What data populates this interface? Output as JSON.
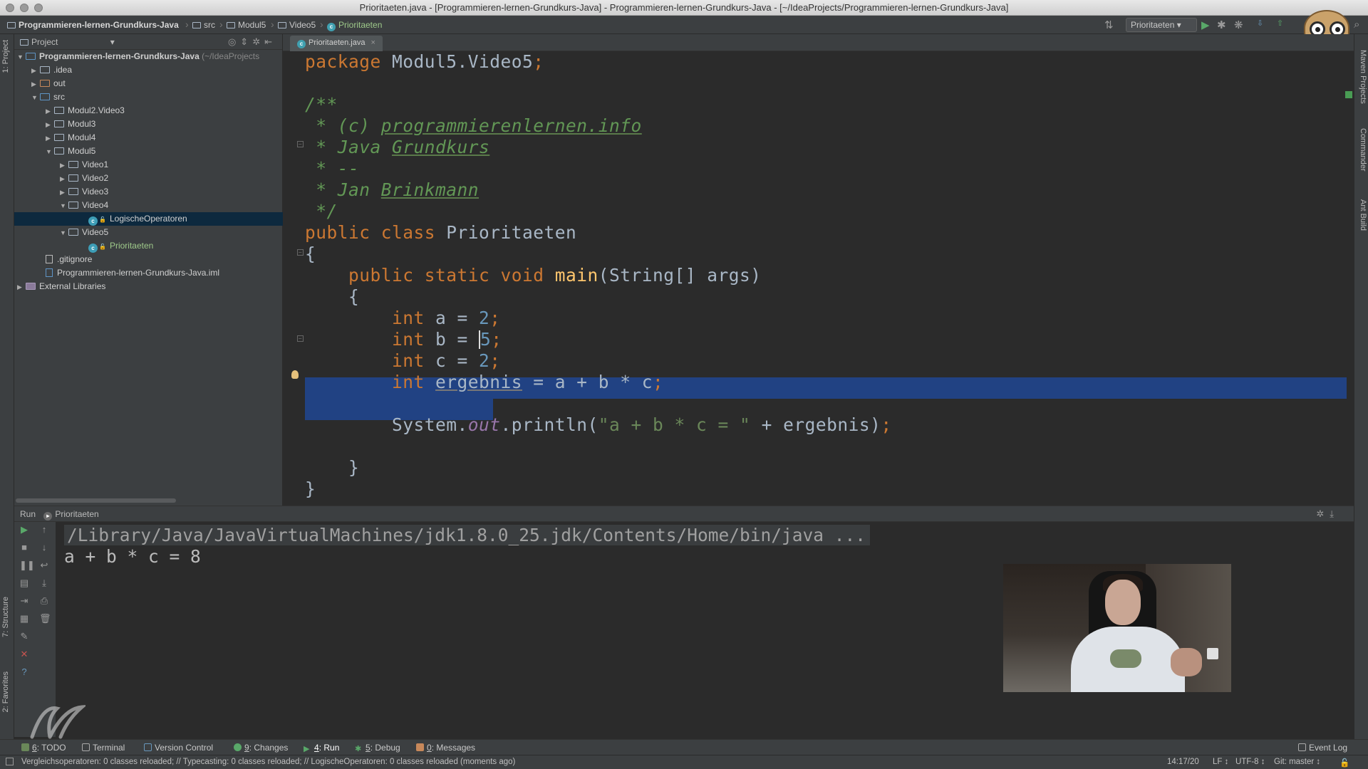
{
  "window": {
    "title": "Prioritaeten.java - [Programmieren-lernen-Grundkurs-Java] - Programmieren-lernen-Grundkurs-Java - [~/IdeaProjects/Programmieren-lernen-Grundkurs-Java]"
  },
  "breadcrumbs": [
    "Programmieren-lernen-Grundkurs-Java",
    "src",
    "Modul5",
    "Video5",
    "Prioritaeten"
  ],
  "toolbar": {
    "run_config": "Prioritaeten",
    "icons": [
      "structure-icon",
      "run-icon",
      "debug-icon",
      "coverage-icon",
      "vcs-update-icon",
      "vcs-commit-icon",
      "settings-icon",
      "search-icon"
    ]
  },
  "left_strip": {
    "project_tab": "1: Project",
    "structure_tab": "7: Structure",
    "favorites_tab": "2: Favorites"
  },
  "right_strip": {
    "maven_tab": "Maven Projects",
    "commander_tab": "Commander",
    "ant_tab": "Ant Build"
  },
  "project_panel": {
    "header": "Project",
    "tree": [
      {
        "label": "Programmieren-lernen-Grundkurs-Java",
        "suffix": " (~/IdeaProjects",
        "kind": "module"
      },
      {
        "label": ".idea",
        "kind": "folder"
      },
      {
        "label": "out",
        "kind": "folder-orange"
      },
      {
        "label": "src",
        "kind": "folder-src"
      },
      {
        "label": "Modul2.Video3",
        "kind": "package"
      },
      {
        "label": "Modul3",
        "kind": "package"
      },
      {
        "label": "Modul4",
        "kind": "package"
      },
      {
        "label": "Modul5",
        "kind": "package"
      },
      {
        "label": "Video1",
        "kind": "package"
      },
      {
        "label": "Video2",
        "kind": "package"
      },
      {
        "label": "Video3",
        "kind": "package"
      },
      {
        "label": "Video4",
        "kind": "package"
      },
      {
        "label": "LogischeOperatoren",
        "kind": "class"
      },
      {
        "label": "Video5",
        "kind": "package"
      },
      {
        "label": "Prioritaeten",
        "kind": "class-active"
      },
      {
        "label": ".gitignore",
        "kind": "file"
      },
      {
        "label": "Programmieren-lernen-Grundkurs-Java.iml",
        "kind": "iml"
      },
      {
        "label": "External Libraries",
        "kind": "library"
      }
    ]
  },
  "editor": {
    "tab_label": "Prioritaeten.java",
    "lines": {
      "l1a": "package ",
      "l1b": "Modul5.Video5",
      "l1c": ";",
      "l3": "/**",
      "l4a": " * (c) ",
      "l4b": "programmierenlernen.info",
      "l5a": " * Java ",
      "l5b": "Grundkurs",
      "l6": " * --",
      "l7a": " * Jan ",
      "l7b": "Brinkmann",
      "l8": " */",
      "l9a": "public class ",
      "l9b": "Prioritaeten",
      "l10": "{",
      "l11a": "    public static void ",
      "l11b": "main",
      "l11c": "(String[] args)",
      "l12": "    {",
      "l13a": "        int ",
      "l13b": "a = ",
      "l13c": "2",
      "l13d": ";",
      "l14a": "        int ",
      "l14b": "b = ",
      "l14c": "5",
      "l14d": ";",
      "l15a": "        int ",
      "l15b": "c = ",
      "l15c": "2",
      "l15d": ";",
      "l16a": "        int ",
      "l16b": "ergebnis",
      "l16c": " = a + b * c",
      "l16d": ";",
      "l18a": "        System.",
      "l18b": "out",
      "l18c": ".println(",
      "l18d": "\"a + b * c = \"",
      "l18e": " + ergebnis)",
      "l18f": ";",
      "l20": "    }",
      "l21": "}"
    }
  },
  "run_panel": {
    "header_label": "Run",
    "config_name": "Prioritaeten",
    "command": "/Library/Java/JavaVirtualMachines/jdk1.8.0_25.jdk/Contents/Home/bin/java ...",
    "output": "a + b * c = 8"
  },
  "bottom_tabs": [
    {
      "num": "6",
      "label": ": TODO"
    },
    {
      "num": "",
      "label": "Terminal"
    },
    {
      "num": "",
      "label": "Version Control"
    },
    {
      "num": "9",
      "label": ": Changes"
    },
    {
      "num": "4",
      "label": ": Run"
    },
    {
      "num": "5",
      "label": ": Debug"
    },
    {
      "num": "0",
      "label": ": Messages"
    }
  ],
  "event_log": "Event Log",
  "status": {
    "message": "Vergleichsoperatoren: 0 classes reloaded; // Typecasting: 0 classes reloaded; // LogischeOperatoren: 0 classes reloaded (moments ago)",
    "position": "14:17/20",
    "line_sep": "LF ↕",
    "encoding": "UTF-8 ↕",
    "vcs": "Git: master ↕"
  },
  "colors": {
    "keyword": "#cc7832",
    "number": "#6897bb",
    "comment": "#629755",
    "method": "#ffc66d",
    "string": "#6a8759",
    "selection": "#214283",
    "tree_selection": "#0d293e"
  }
}
